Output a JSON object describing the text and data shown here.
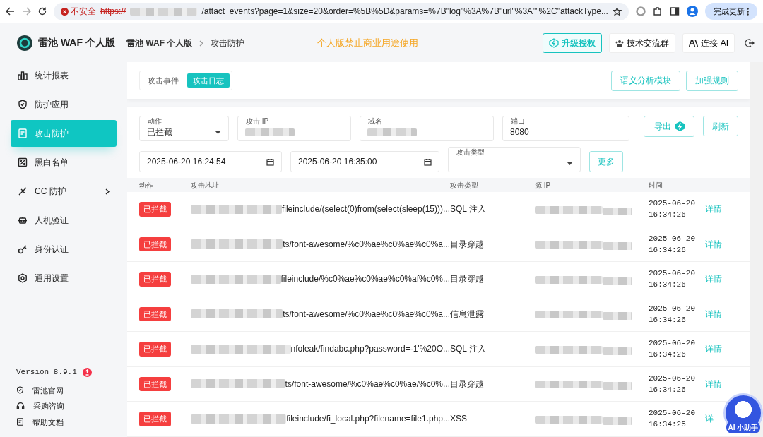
{
  "browser": {
    "security_label": "不安全",
    "url_scheme": "https://",
    "url_path": "/attact_events?page=1&size=20&order=%5B%5D&params=%7B\"log\"%3A%7B\"url\"%3A\"\"%2C\"attackType...",
    "update_button": "完成更新"
  },
  "header": {
    "logo_text": "雷池 WAF 个人版",
    "breadcrumb": [
      "雷池 WAF 个人版",
      "攻击防护"
    ],
    "notice": "个人版禁止商业用途使用",
    "buttons": [
      {
        "label": "升级授权",
        "kind": "upgrade"
      },
      {
        "label": "技术交流群",
        "kind": "group"
      },
      {
        "label": "连接 AI",
        "kind": "ai"
      }
    ]
  },
  "sidebar": {
    "items": [
      {
        "label": "统计报表",
        "selected": false,
        "expandable": false
      },
      {
        "label": "防护应用",
        "selected": false,
        "expandable": false
      },
      {
        "label": "攻击防护",
        "selected": true,
        "expandable": false
      },
      {
        "label": "黑白名单",
        "selected": false,
        "expandable": false
      },
      {
        "label": "CC 防护",
        "selected": false,
        "expandable": true
      },
      {
        "label": "人机验证",
        "selected": false,
        "expandable": false
      },
      {
        "label": "身份认证",
        "selected": false,
        "expandable": false
      },
      {
        "label": "通用设置",
        "selected": false,
        "expandable": false
      }
    ],
    "version": "Version 8.9.1",
    "links": [
      "雷池官网",
      "采购咨询",
      "帮助文档"
    ]
  },
  "tabs": [
    {
      "label": "攻击事件",
      "selected": false
    },
    {
      "label": "攻击日志",
      "selected": true
    }
  ],
  "top_buttons": [
    "语义分析模块",
    "加强规则"
  ],
  "filters": {
    "fields": [
      {
        "label": "动作",
        "value": "已拦截",
        "kind": "select"
      },
      {
        "label": "攻击 IP",
        "kind": "redacted"
      },
      {
        "label": "域名",
        "kind": "redacted"
      },
      {
        "label": "端口",
        "value": "8080",
        "kind": "text"
      }
    ],
    "start_time": "2025-06-20 16:24:54",
    "end_time": "2025-06-20 16:35:00",
    "attack_type_label": "攻击类型",
    "export_button": "导出",
    "refresh_button": "刷新",
    "more_button": "更多"
  },
  "table": {
    "columns": [
      "动作",
      "攻击地址",
      "攻击类型",
      "源 IP",
      "时间"
    ],
    "rows": [
      {
        "action": "已拦截",
        "address": "fileinclude/(select(0)from(select(sleep(15)))...",
        "type": "SQL 注入",
        "date": "2025-06-20",
        "time": "16:34:26",
        "detail": "详情"
      },
      {
        "action": "已拦截",
        "address": "ts/font-awesome/%c0%ae%c0%ae%c0%a...",
        "type": "目录穿越",
        "date": "2025-06-20",
        "time": "16:34:26",
        "detail": "详情"
      },
      {
        "action": "已拦截",
        "address": "fileinclude/%c0%ae%c0%ae%c0%af%c0%...",
        "type": "目录穿越",
        "date": "2025-06-20",
        "time": "16:34:26",
        "detail": "详情"
      },
      {
        "action": "已拦截",
        "address": "ts/font-awesome/%c0%ae%c0%ae%c0%a...",
        "type": "信息泄露",
        "date": "2025-06-20",
        "time": "16:34:26",
        "detail": "详情"
      },
      {
        "action": "已拦截",
        "address": "nfoleak/findabc.php?password=-1'%20O...",
        "type": "SQL 注入",
        "date": "2025-06-20",
        "time": "16:34:26",
        "detail": "详情"
      },
      {
        "action": "已拦截",
        "address": "ts/font-awesome/%c0%ae%c0%ae/%c0%...",
        "type": "目录穿越",
        "date": "2025-06-20",
        "time": "16:34:26",
        "detail": "详情"
      },
      {
        "action": "已拦截",
        "address": "fileinclude/fi_local.php?filename=file1.php...",
        "type": "XSS",
        "date": "2025-06-20",
        "time": "16:34:25",
        "detail": "详"
      }
    ]
  },
  "assistant_button": "AI 小助手"
}
